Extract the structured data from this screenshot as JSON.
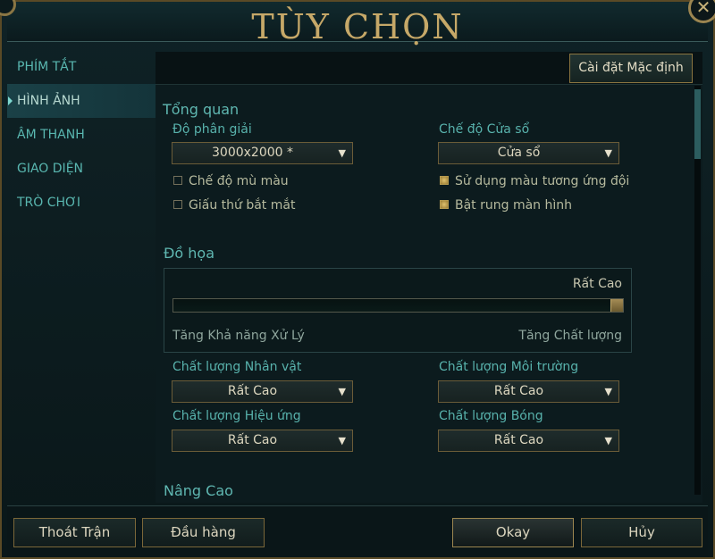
{
  "window": {
    "title": "TÙY CHỌN"
  },
  "sidebar": {
    "items": [
      {
        "label": "PHÍM TẮT",
        "active": false
      },
      {
        "label": "HÌNH ẢNH",
        "active": true
      },
      {
        "label": "ÂM THANH",
        "active": false
      },
      {
        "label": "GIAO DIỆN",
        "active": false
      },
      {
        "label": "TRÒ CHƠI",
        "active": false
      }
    ]
  },
  "toolbar": {
    "reset_label": "Cài đặt Mặc định"
  },
  "overview": {
    "title": "Tổng quan",
    "resolution": {
      "label": "Độ phân giải",
      "value": "3000x2000 *"
    },
    "window_mode": {
      "label": "Chế độ Cửa sổ",
      "value": "Cửa sổ"
    },
    "colorblind": {
      "label": "Chế độ mù màu",
      "checked": false
    },
    "team_colors": {
      "label": "Sử dụng màu tương ứng đội",
      "checked": true
    },
    "hide_eye_candy": {
      "label": "Giấu thứ bắt mắt",
      "checked": false
    },
    "screen_shake": {
      "label": "Bật rung màn hình",
      "checked": true
    }
  },
  "graphics": {
    "title": "Đồ họa",
    "level_label": "Rất Cao",
    "level_fraction": 1.0,
    "left_caption": "Tăng Khả năng Xử Lý",
    "right_caption": "Tăng Chất lượng",
    "character_quality": {
      "label": "Chất lượng Nhân vật",
      "value": "Rất Cao"
    },
    "environment_quality": {
      "label": "Chất lượng Môi trường",
      "value": "Rất Cao"
    },
    "effects_quality": {
      "label": "Chất lượng Hiệu ứng",
      "value": "Rất Cao"
    },
    "shadow_quality": {
      "label": "Chất lượng Bóng",
      "value": "Rất Cao"
    }
  },
  "advanced": {
    "title": "Nâng Cao"
  },
  "footer": {
    "exit_match": "Thoát Trận",
    "surrender": "Đầu hàng",
    "okay": "Okay",
    "cancel": "Hủy"
  },
  "icons": {
    "close": "close-icon",
    "dropdown": "chevron-down-icon",
    "arrow_glyph": "▼",
    "close_glyph": "✕"
  },
  "colors": {
    "accent_teal": "#59b7b0",
    "gold": "#c6a868",
    "checked_gold": "#c9a95a"
  }
}
